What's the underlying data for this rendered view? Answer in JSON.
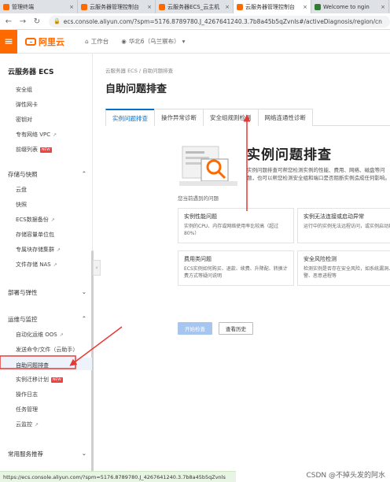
{
  "browser": {
    "tabs": [
      {
        "label": "管理终端",
        "color": "#ff6a00",
        "active": false
      },
      {
        "label": "云服务器管理控制台",
        "color": "#ff6a00",
        "active": false
      },
      {
        "label": "云服务器ECS_云主机",
        "color": "#ff6a00",
        "active": false
      },
      {
        "label": "云服务器管理控制台",
        "color": "#ff6a00",
        "active": true
      },
      {
        "label": "Welcome to ngin",
        "color": "#2e7d32",
        "active": false
      }
    ],
    "url": "ecs.console.aliyun.com/?spm=5176.8789780.J_4267641240.3.7b8a45b5qZvnls#/activeDiagnosis/region/cn"
  },
  "header": {
    "logo_text": "阿里云",
    "workbench": "工作台",
    "region": "华北6（乌兰察布）"
  },
  "sidebar": {
    "title": "云服务器 ECS",
    "items": [
      {
        "label": "安全组",
        "new": false,
        "ext": false
      },
      {
        "label": "弹性网卡",
        "new": false,
        "ext": false
      },
      {
        "label": "密钥对",
        "new": false,
        "ext": false
      },
      {
        "label": "专有网络 VPC",
        "new": false,
        "ext": true
      },
      {
        "label": "前缀列表",
        "new": true,
        "ext": false
      }
    ],
    "groups": [
      {
        "label": "存储与快照",
        "expanded": true
      },
      {
        "label": "部署与弹性",
        "expanded": false
      },
      {
        "label": "运维与监控",
        "expanded": true
      },
      {
        "label": "常用服务推荐",
        "expanded": false
      }
    ],
    "storage_items": [
      {
        "label": "云盘",
        "new": false,
        "ext": false
      },
      {
        "label": "快照",
        "new": false,
        "ext": false
      },
      {
        "label": "ECS数据备份",
        "new": false,
        "ext": true
      },
      {
        "label": "存储容量单位包",
        "new": false,
        "ext": false
      },
      {
        "label": "专属块存储集群",
        "new": false,
        "ext": true
      },
      {
        "label": "文件存储 NAS",
        "new": false,
        "ext": true
      }
    ],
    "ops_items": [
      {
        "label": "自动化运维 OOS",
        "new": false,
        "ext": true
      },
      {
        "label": "发送命令/文件（云助手）",
        "new": false,
        "ext": false
      },
      {
        "label": "自助问题排查",
        "new": false,
        "ext": false,
        "active": true
      },
      {
        "label": "实例迁移计划",
        "new": true,
        "ext": false
      },
      {
        "label": "操作日志",
        "new": false,
        "ext": false
      },
      {
        "label": "任务管理",
        "new": false,
        "ext": false
      },
      {
        "label": "云监控",
        "new": false,
        "ext": true
      }
    ]
  },
  "main": {
    "breadcrumb": "云服务器 ECS  /  自助问题排查",
    "title": "自助问题排查",
    "tabs": [
      "实例问题排查",
      "操作异常诊断",
      "安全组规则检测",
      "网络连通性诊断"
    ],
    "hero_title": "实例问题排查",
    "hero_desc": "实例问题排查可帮您检测实例的性能、费用、网络、磁盘等问题，也可以帮您检测安全组和端口是否阻断实例造成任何影响。",
    "section_label": "您当前遇到的问题",
    "cards": [
      {
        "title": "实例性能问题",
        "desc": "实例的CPU、内存或网络使用率比较高（超过80%）"
      },
      {
        "title": "实例无法连接或启动异常",
        "desc": "运行中的实例无法远程访问，或实例启动异常"
      },
      {
        "title": "费用类问题",
        "desc": "ECS实例如何购买、退款、续费、升降配、转换计费方式等疑问说明"
      },
      {
        "title": "安全风险检测",
        "desc": "检测实例是否存在安全风险，如系统漏洞、安全告警、恶意进程等"
      }
    ],
    "btn_start": "开始检查",
    "btn_history": "查看历史"
  },
  "statusbar": "https://ecs.console.aliyun.com/?spm=5176.8789780.J_4267641240.3.7b8a45b5qZvnls",
  "watermark": "CSDN @不掉头发的阿水",
  "colors": {
    "brand": "#ff6a00",
    "link": "#0070cc",
    "annotation": "#e53935"
  }
}
